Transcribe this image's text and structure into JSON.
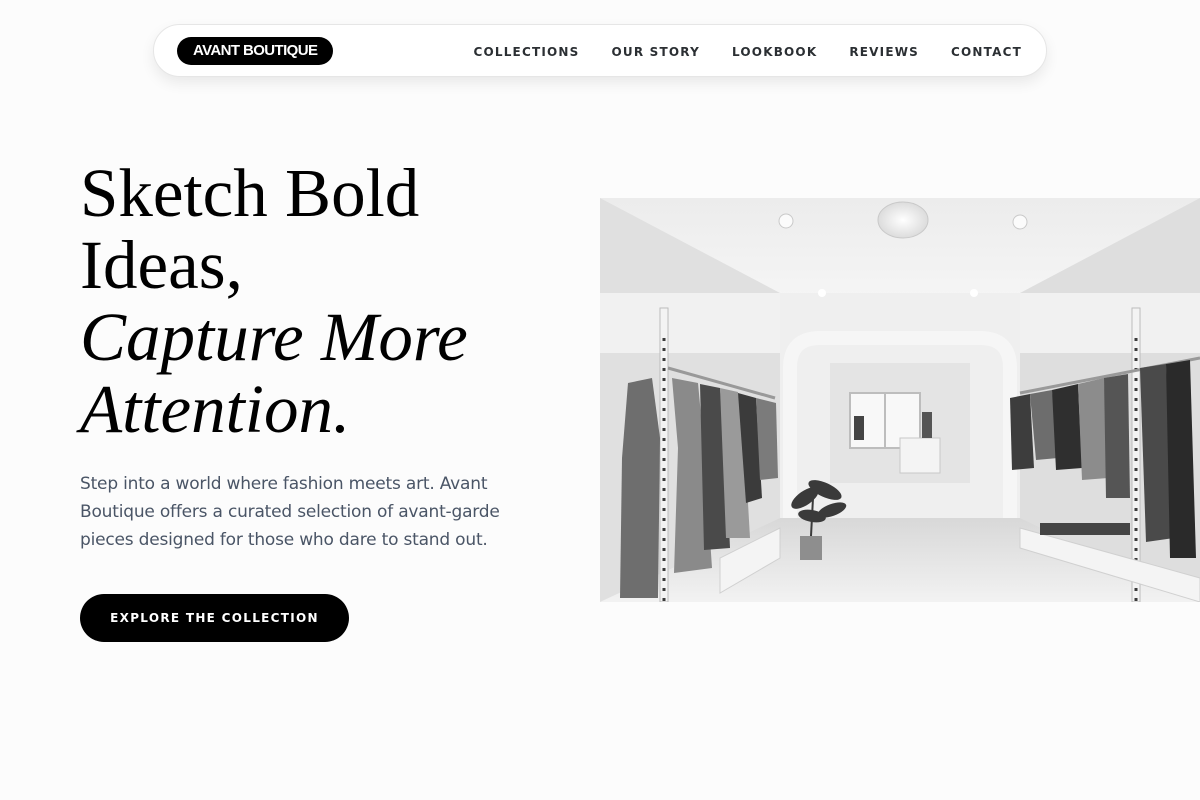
{
  "nav": {
    "brand": "AVANT BOUTIQUE",
    "links": [
      "COLLECTIONS",
      "OUR STORY",
      "LOOKBOOK",
      "REVIEWS",
      "CONTACT"
    ]
  },
  "hero": {
    "title_line1": "Sketch Bold",
    "title_line2": "Ideas,",
    "title_line3": "Capture More",
    "title_line4": "Attention.",
    "description": "Step into a world where fashion meets art. Avant Boutique offers a curated selection of avant-garde pieces designed for those who dare to stand out.",
    "cta_label": "EXPLORE THE COLLECTION"
  },
  "colors": {
    "background": "#fcfcfc",
    "accent": "#000000",
    "body_text": "#4a5566"
  }
}
